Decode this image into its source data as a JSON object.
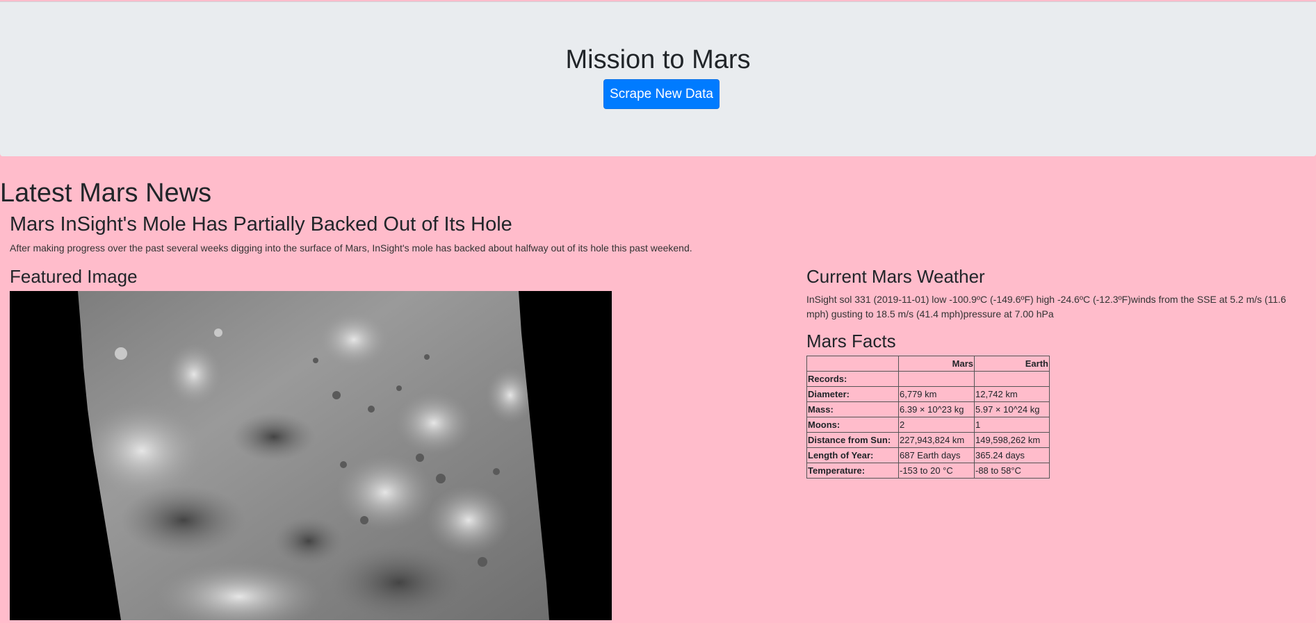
{
  "header": {
    "title": "Mission to Mars",
    "scrape_button_label": "Scrape New Data"
  },
  "news": {
    "section_heading": "Latest Mars News",
    "title": "Mars InSight's Mole Has Partially Backed Out of Its Hole",
    "teaser": "After making progress over the past several weeks digging into the surface of Mars, InSight's mole has backed about halfway out of its hole this past weekend."
  },
  "featured": {
    "heading": "Featured Image"
  },
  "weather": {
    "heading": "Current Mars Weather",
    "text": "InSight sol 331 (2019-11-01) low -100.9ºC (-149.6ºF) high -24.6ºC (-12.3ºF)winds from the SSE at 5.2 m/s (11.6 mph) gusting to 18.5 m/s (41.4 mph)pressure at 7.00 hPa"
  },
  "facts": {
    "heading": "Mars Facts",
    "columns": [
      "",
      "Mars",
      "Earth"
    ],
    "rows": [
      {
        "label": "Records:",
        "mars": "",
        "earth": ""
      },
      {
        "label": "Diameter:",
        "mars": "6,779 km",
        "earth": "12,742 km"
      },
      {
        "label": "Mass:",
        "mars": "6.39 × 10^23 kg",
        "earth": "5.97 × 10^24 kg"
      },
      {
        "label": "Moons:",
        "mars": "2",
        "earth": "1"
      },
      {
        "label": "Distance from Sun:",
        "mars": "227,943,824 km",
        "earth": "149,598,262 km"
      },
      {
        "label": "Length of Year:",
        "mars": "687 Earth days",
        "earth": "365.24 days"
      },
      {
        "label": "Temperature:",
        "mars": "-153 to 20 °C",
        "earth": "-88 to 58°C"
      }
    ]
  },
  "colors": {
    "page_background": "#ffbccb",
    "jumbotron_background": "#e9ecef",
    "button_primary": "#007bff",
    "text": "#212529"
  }
}
